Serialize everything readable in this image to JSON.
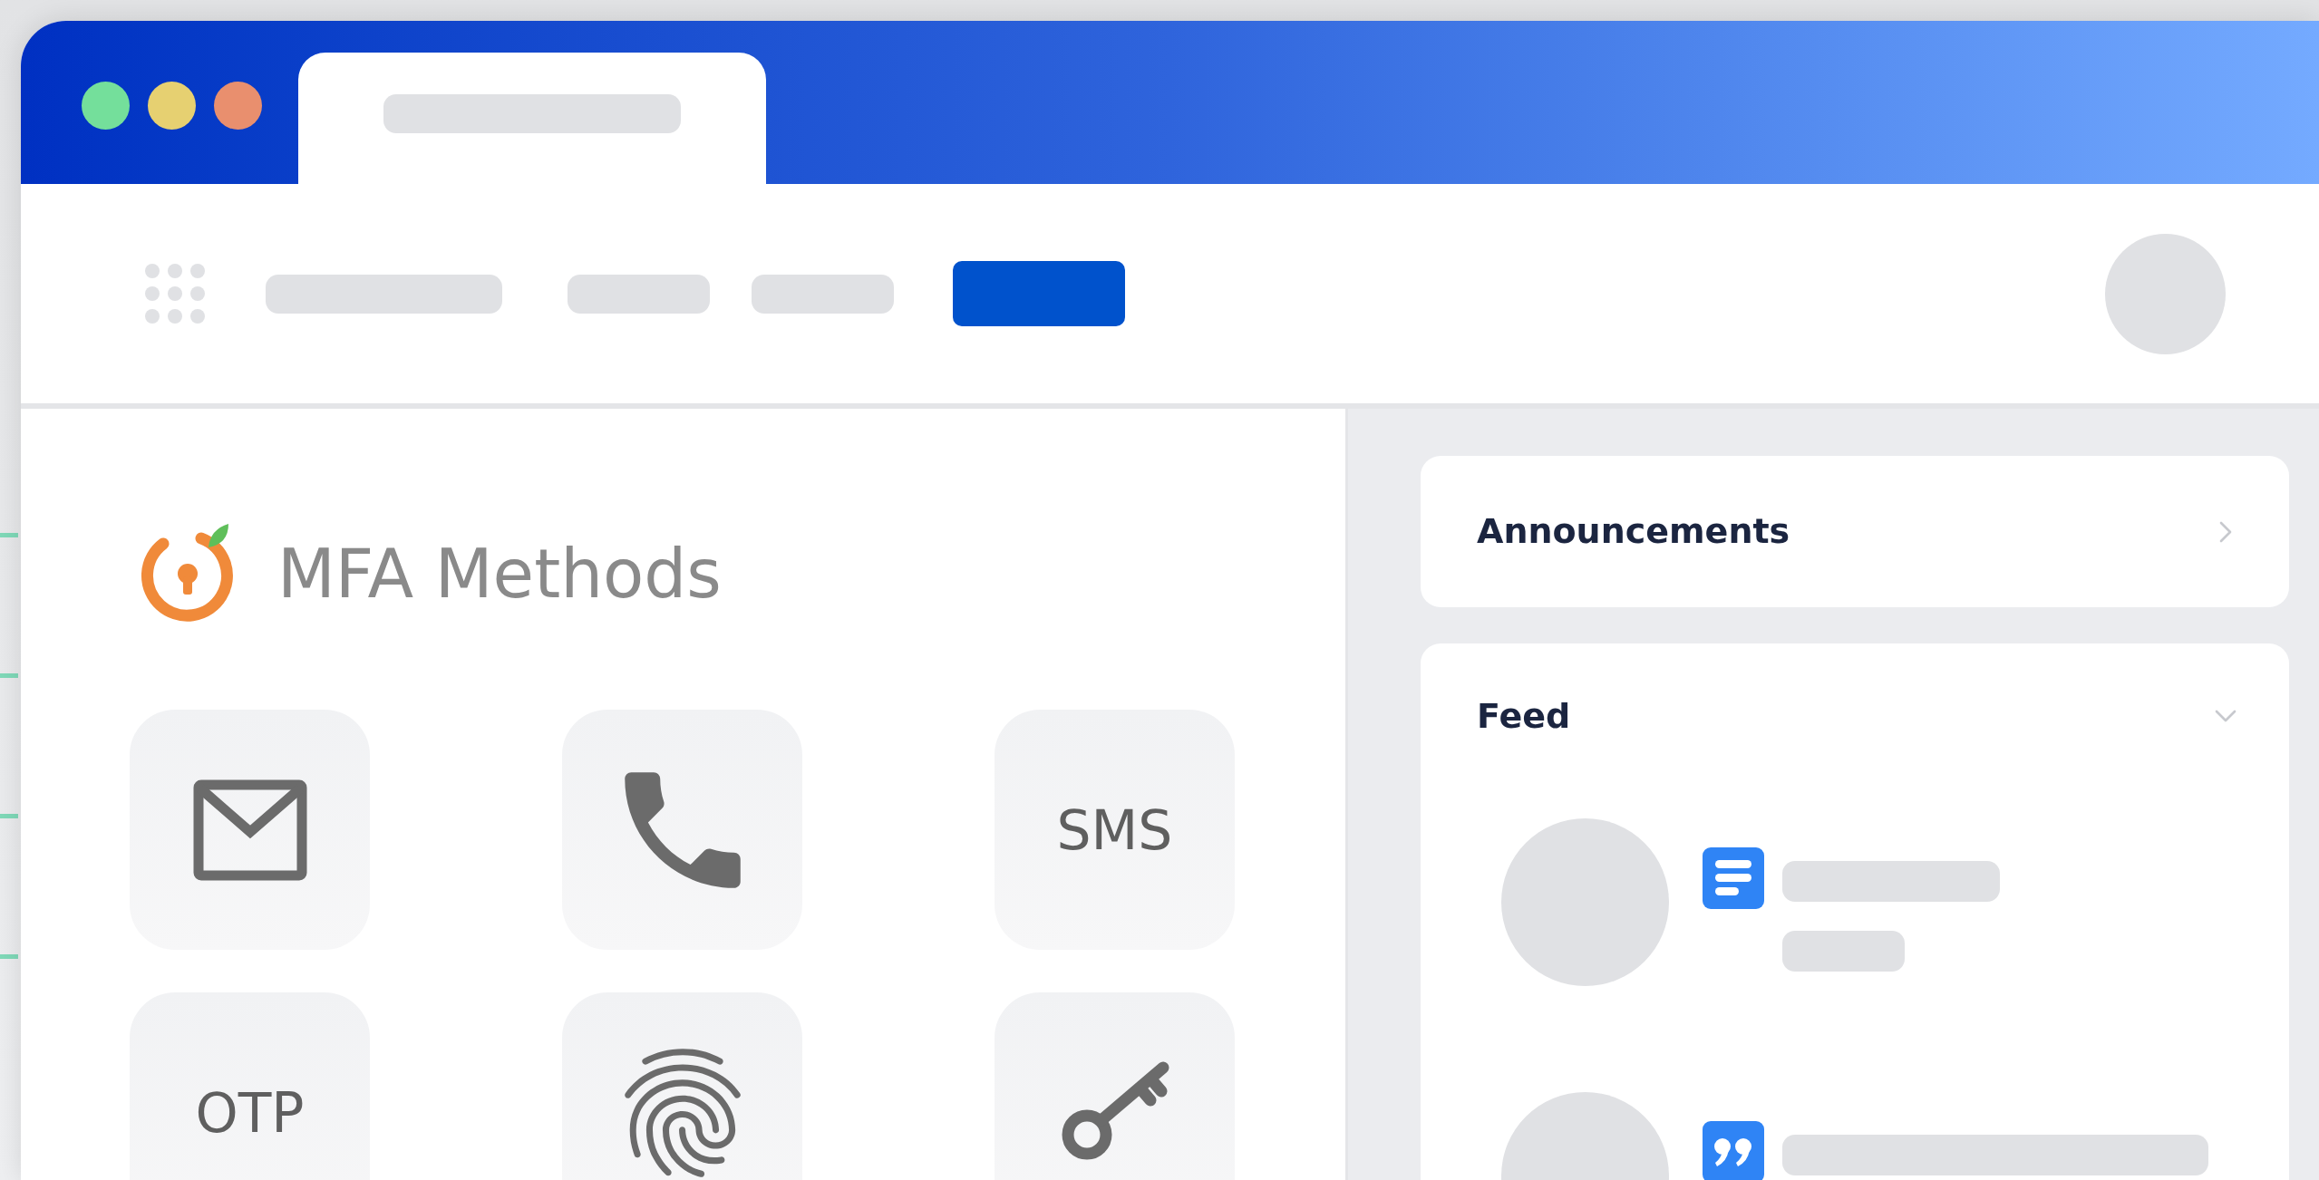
{
  "window_controls": [
    {
      "color": "#74df9b"
    },
    {
      "color": "#e6d071"
    },
    {
      "color": "#e98f6e"
    }
  ],
  "mfa_panel": {
    "title": "MFA Methods",
    "methods": [
      {
        "kind": "mail"
      },
      {
        "kind": "phone"
      },
      {
        "kind": "text",
        "label": "SMS"
      },
      {
        "kind": "text",
        "label": "OTP"
      },
      {
        "kind": "fingerprint"
      },
      {
        "kind": "key"
      }
    ]
  },
  "announcements": {
    "title": "Announcements",
    "expanded": false
  },
  "feed": {
    "title": "Feed",
    "expanded": true,
    "items": [
      {
        "kind": "document"
      },
      {
        "kind": "quote"
      }
    ]
  }
}
